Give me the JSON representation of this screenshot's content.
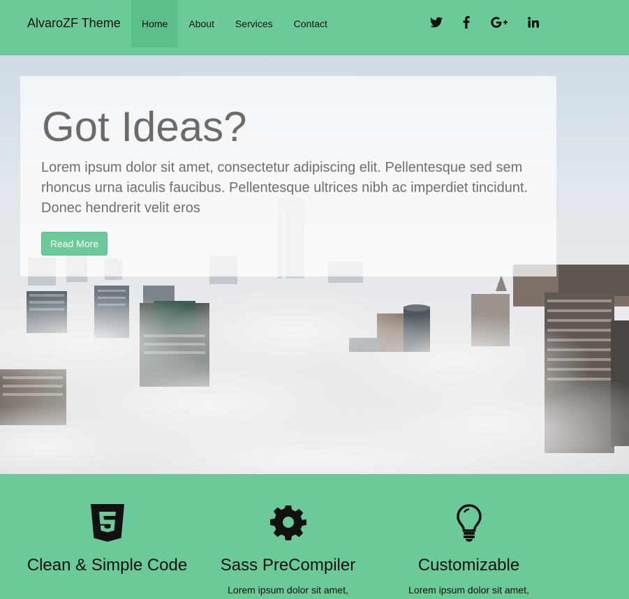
{
  "navbar": {
    "brand": "AlvaroZF Theme",
    "items": [
      {
        "label": "Home",
        "active": true
      },
      {
        "label": "About",
        "active": false
      },
      {
        "label": "Services",
        "active": false
      },
      {
        "label": "Contact",
        "active": false
      }
    ],
    "social": [
      "twitter-icon",
      "facebook-icon",
      "google-plus-icon",
      "linkedin-icon"
    ]
  },
  "hero": {
    "title": "Got Ideas?",
    "text": "Lorem ipsum dolor sit amet, consectetur adipiscing elit. Pellentesque sed sem rhoncus urna iaculis faucibus. Pellentesque ultrices nibh ac imperdiet tincidunt. Donec hendrerit velit eros",
    "button_label": "Read More"
  },
  "features": [
    {
      "icon": "html5-icon",
      "title": "Clean & Simple Code",
      "text": "Lorem ipsum dolor sit amet,"
    },
    {
      "icon": "gear-icon",
      "title": "Sass PreCompiler",
      "text": "Lorem ipsum dolor sit amet,"
    },
    {
      "icon": "lightbulb-icon",
      "title": "Customizable",
      "text": "Lorem ipsum dolor sit amet,"
    }
  ],
  "colors": {
    "accent": "#6cc99a",
    "accent_active": "#5bbf8c",
    "text": "#111111"
  }
}
